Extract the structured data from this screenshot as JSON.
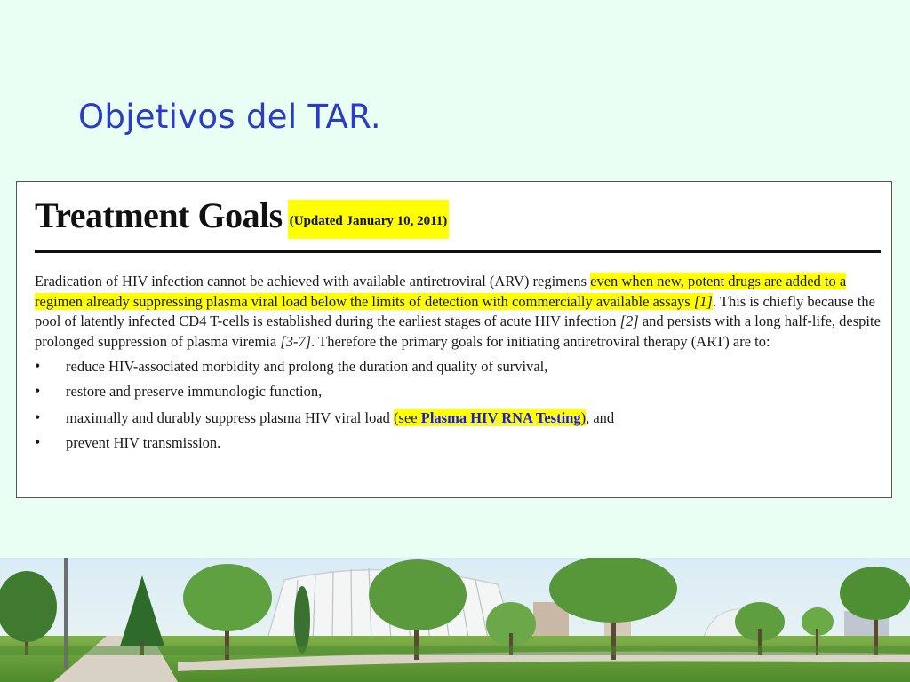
{
  "slide": {
    "title": "Objetivos del TAR."
  },
  "document": {
    "heading": "Treatment Goals",
    "updated": "(Updated January 10, 2011)",
    "paragraph": {
      "p1": "Eradication of HIV infection cannot be achieved with available antiretroviral (ARV) regimens ",
      "p2_highlight": "even when new, potent drugs are added to a regimen already suppressing plasma viral load below the limits of detection with commercially available assays ",
      "ref1": "[1]",
      "p3": ". This is chiefly because the pool of latently infected CD4 T-cells is established during the earliest stages of acute HIV infection ",
      "ref2": "[2]",
      "p4": " and persists with a long half-life, despite prolonged suppression of plasma viremia ",
      "ref3": "[3-7]",
      "p5": ". Therefore the primary goals for initiating antiretroviral therapy (ART) are to:"
    },
    "goals": {
      "g1": "reduce HIV-associated morbidity and prolong the duration and quality of survival,",
      "g2": "restore and preserve immunologic function,",
      "g3_pre": "maximally and durably suppress plasma HIV viral load ",
      "g3_open": "(see ",
      "g3_link": "Plasma HIV RNA Testing",
      "g3_close": ")",
      "g3_post": ", and",
      "g4": "prevent HIV transmission."
    }
  },
  "colors": {
    "title": "#2b3bc9",
    "highlight": "#ffff00",
    "link": "#1a1ae0",
    "background": "#eafff4"
  }
}
